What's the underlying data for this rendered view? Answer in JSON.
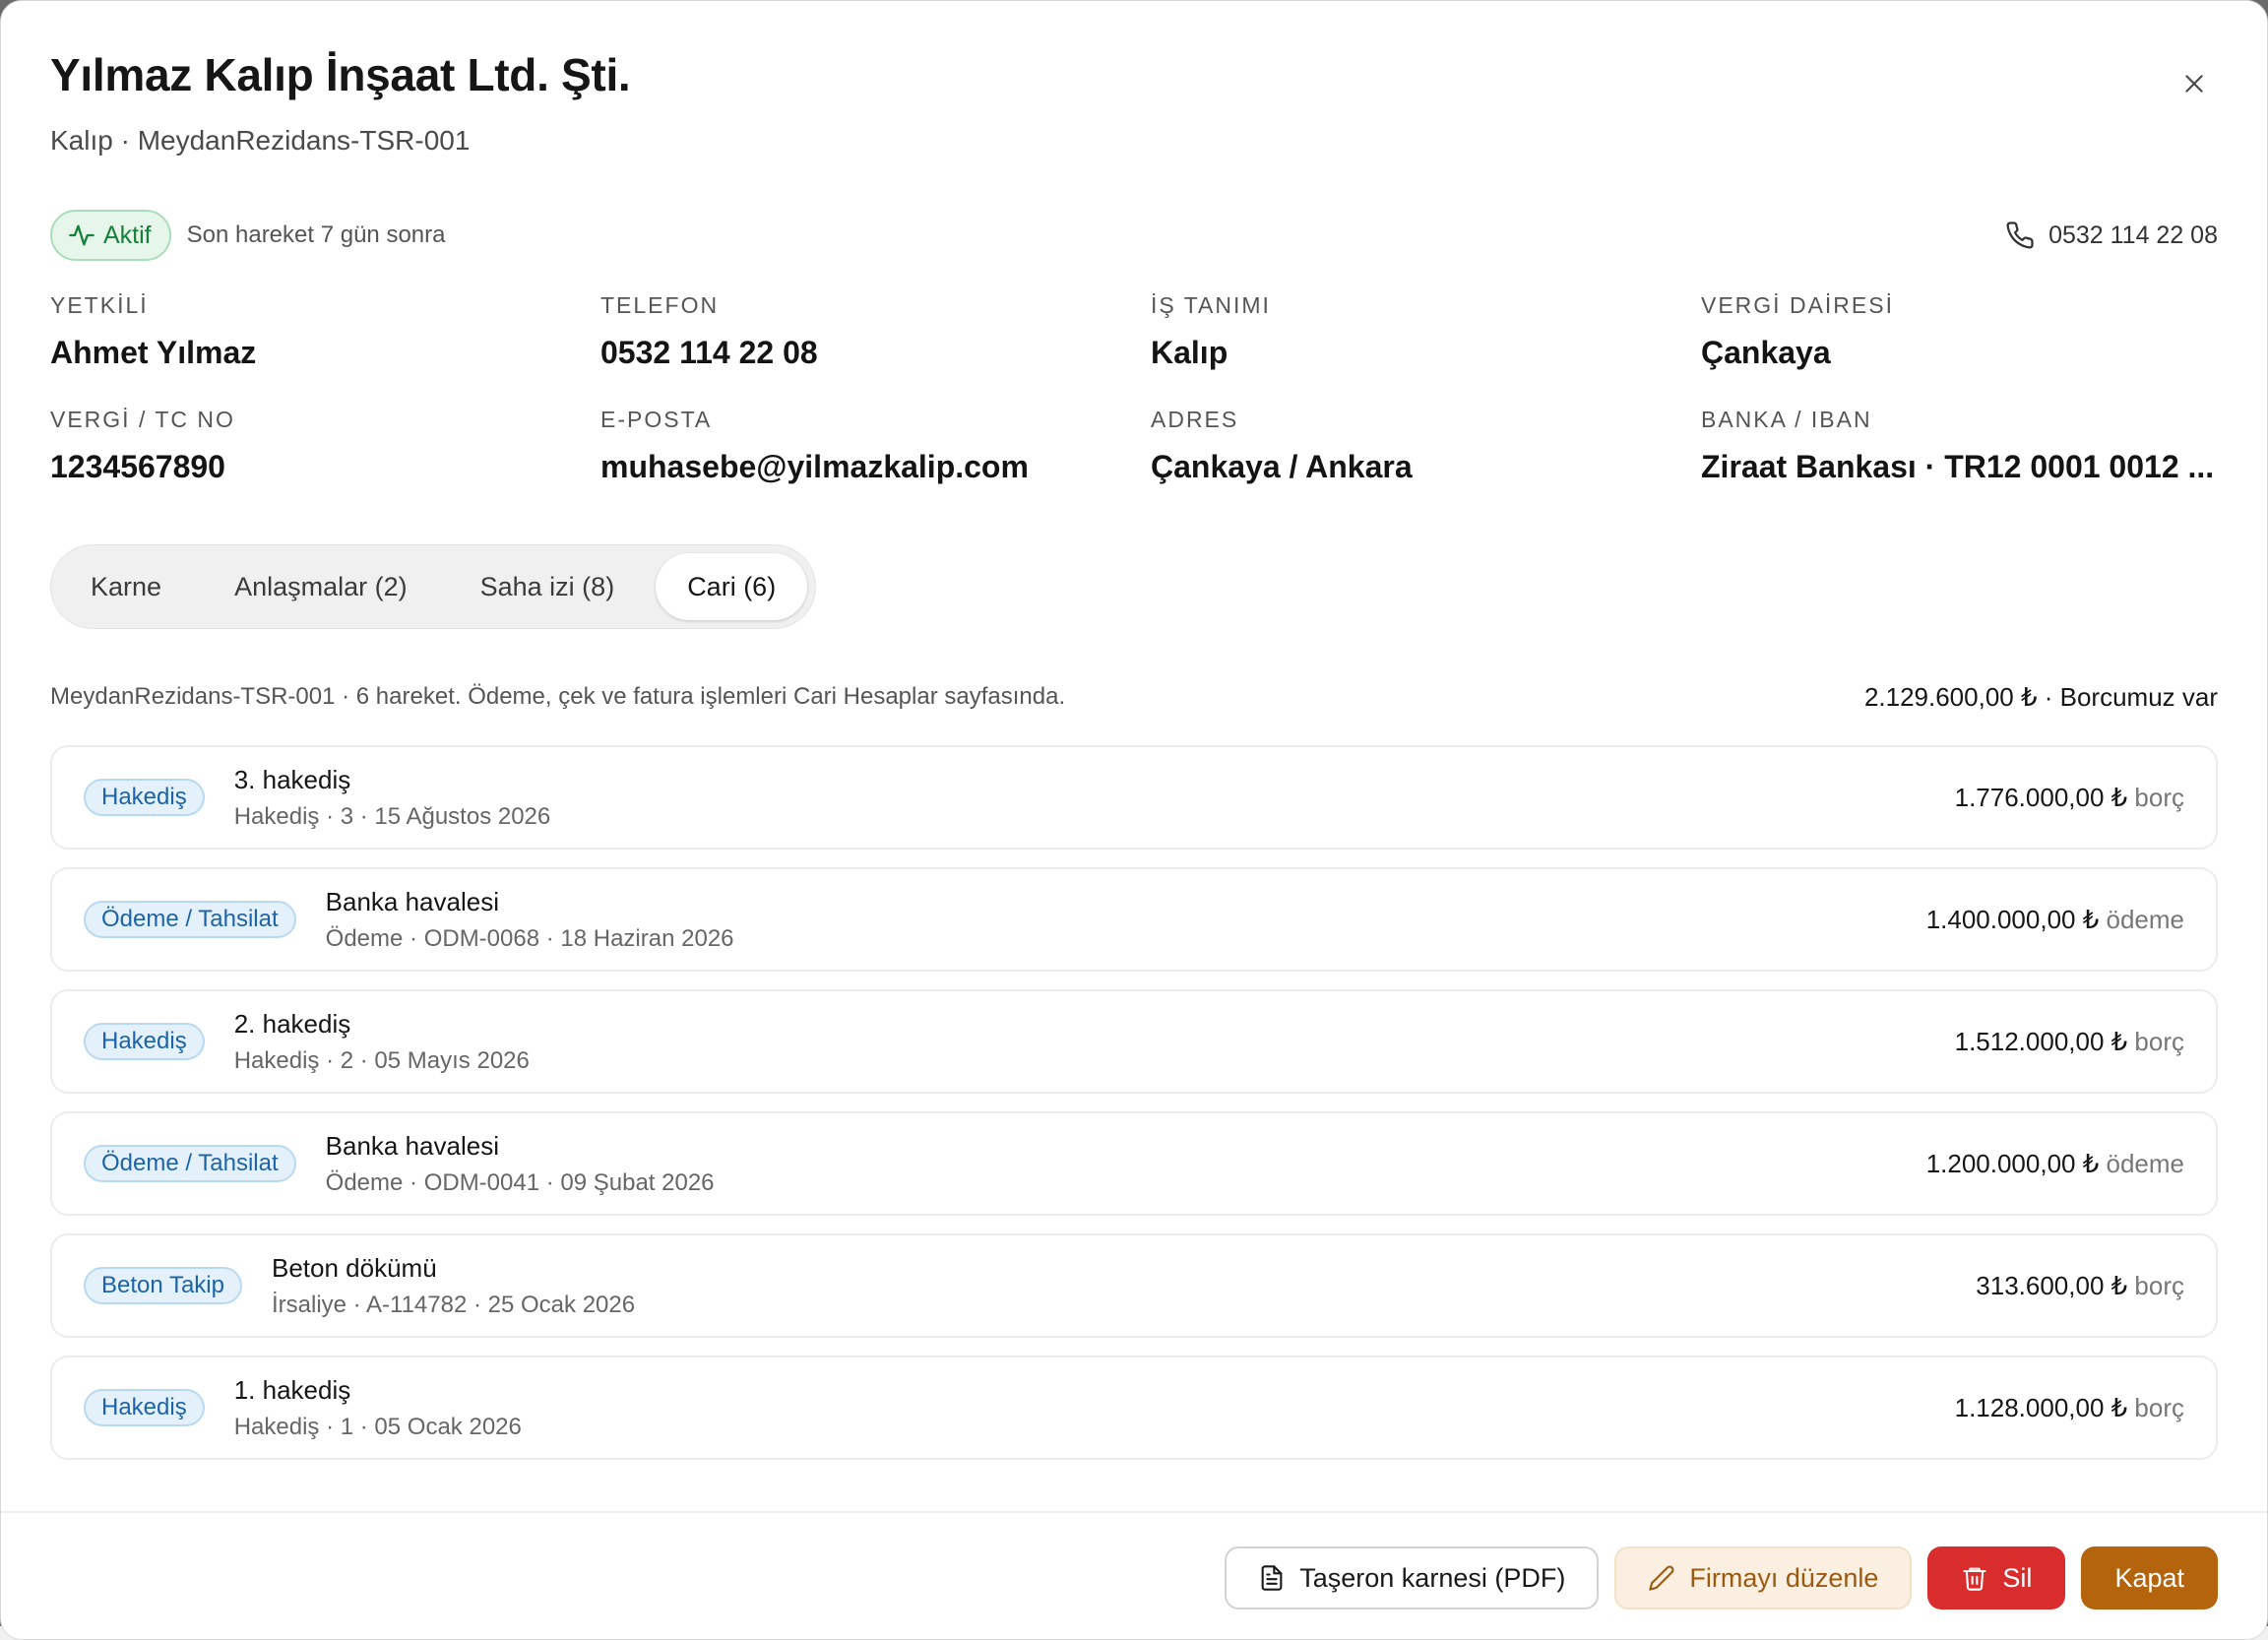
{
  "modal": {
    "title": "Yılmaz Kalıp İnşaat Ltd. Şti.",
    "subtitle": "Kalıp · MeydanRezidans-TSR-001",
    "close_icon": "close-icon"
  },
  "status": {
    "badge_label": "Aktif",
    "badge_icon": "activity-icon",
    "note": "Son hareket 7 gün sonra",
    "phone": "0532 114 22 08",
    "phone_icon": "phone-icon"
  },
  "info": [
    {
      "label": "YETKİLİ",
      "value": "Ahmet Yılmaz"
    },
    {
      "label": "TELEFON",
      "value": "0532 114 22 08"
    },
    {
      "label": "İŞ TANIMI",
      "value": "Kalıp"
    },
    {
      "label": "VERGİ DAİRESİ",
      "value": "Çankaya"
    },
    {
      "label": "VERGİ / TC NO",
      "value": "1234567890"
    },
    {
      "label": "E-POSTA",
      "value": "muhasebe@yilmazkalip.com"
    },
    {
      "label": "ADRES",
      "value": "Çankaya / Ankara"
    },
    {
      "label": "BANKA / IBAN",
      "value": "Ziraat Bankası · TR12 0001 0012 ..."
    }
  ],
  "tabs": [
    {
      "label": "Karne",
      "active": false
    },
    {
      "label": "Anlaşmalar (2)",
      "active": false
    },
    {
      "label": "Saha izi (8)",
      "active": false
    },
    {
      "label": "Cari (6)",
      "active": true
    }
  ],
  "summary": {
    "text": "MeydanRezidans-TSR-001 · 6 hareket. Ödeme, çek ve fatura işlemleri Cari Hesaplar sayfasında.",
    "total": "2.129.600,00 ₺ · Borcumuz var"
  },
  "transactions": [
    {
      "tag": "Hakediş",
      "title": "3. hakediş",
      "sub": "Hakediş · 3 · 15 Ağustos 2026",
      "amount": "1.776.000,00 ₺",
      "kind": "borç"
    },
    {
      "tag": "Ödeme / Tahsilat",
      "title": "Banka havalesi",
      "sub": "Ödeme · ODM-0068 · 18 Haziran 2026",
      "amount": "1.400.000,00 ₺",
      "kind": "ödeme"
    },
    {
      "tag": "Hakediş",
      "title": "2. hakediş",
      "sub": "Hakediş · 2 · 05 Mayıs 2026",
      "amount": "1.512.000,00 ₺",
      "kind": "borç"
    },
    {
      "tag": "Ödeme / Tahsilat",
      "title": "Banka havalesi",
      "sub": "Ödeme · ODM-0041 · 09 Şubat 2026",
      "amount": "1.200.000,00 ₺",
      "kind": "ödeme"
    },
    {
      "tag": "Beton Takip",
      "title": "Beton dökümü",
      "sub": "İrsaliye · A-114782 · 25 Ocak 2026",
      "amount": "313.600,00 ₺",
      "kind": "borç"
    },
    {
      "tag": "Hakediş",
      "title": "1. hakediş",
      "sub": "Hakediş · 1 · 05 Ocak 2026",
      "amount": "1.128.000,00 ₺",
      "kind": "borç"
    }
  ],
  "footer": {
    "pdf_label": "Taşeron karnesi (PDF)",
    "pdf_icon": "file-text-icon",
    "edit_label": "Firmayı düzenle",
    "edit_icon": "pencil-icon",
    "delete_label": "Sil",
    "delete_icon": "trash-icon",
    "close_label": "Kapat"
  },
  "colors": {
    "active_green": "#17803a",
    "tag_blue": "#1d63a8",
    "danger": "#d92d2d",
    "primary": "#b3640c"
  }
}
